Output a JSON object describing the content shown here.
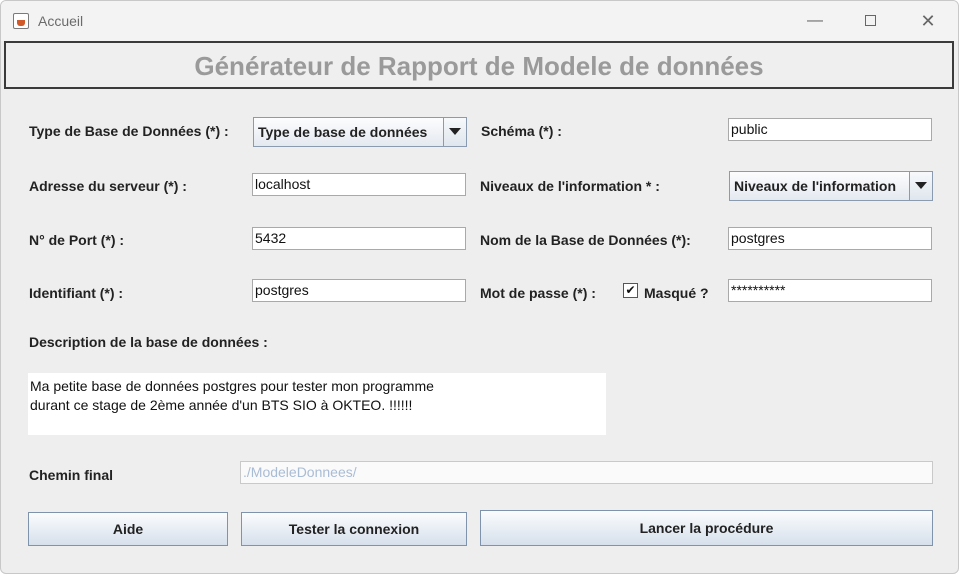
{
  "window": {
    "title": "Accueil",
    "minimize_glyph": "—",
    "close_glyph": "✕"
  },
  "header": {
    "title": "Générateur de Rapport de Modele de données"
  },
  "form": {
    "db_type_label": "Type de Base de Données (*) :",
    "db_type_value": "Type de base de données",
    "schema_label": "Schéma (*) :",
    "schema_value": "public",
    "server_label": "Adresse du serveur  (*) :",
    "server_value": "localhost",
    "info_level_label": "Niveaux de l'information * :",
    "info_level_value": "Niveaux de l'information",
    "port_label": "N° de Port (*) :",
    "port_value": "5432",
    "db_name_label": "Nom de la Base de Données (*):",
    "db_name_value": "postgres",
    "login_label": "Identifiant (*) :",
    "login_value": "postgres",
    "password_label": "Mot de passe (*) :",
    "masked_check": "✔",
    "masked_label": "Masqué ?",
    "password_value": "**********",
    "description_label": "Description de la base de données :",
    "description_line1": "Ma petite base de données postgres pour tester mon programme",
    "description_line2": "durant ce stage de 2ème année d'un BTS SIO à OKTEO. !!!!!!",
    "final_path_label": "Chemin final",
    "final_path_value": "./ModeleDonnees/"
  },
  "buttons": {
    "help": "Aide",
    "test": "Tester la connexion",
    "launch": "Lancer la procédure"
  }
}
